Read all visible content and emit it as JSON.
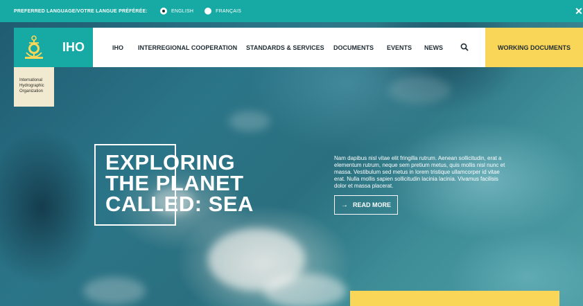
{
  "language_bar": {
    "label": "PREFERRED LANGUAGE/VOTRE LANGUE PRÉFÉRÉE:",
    "options": [
      {
        "label": "ENGLISH",
        "selected": true
      },
      {
        "label": "FRANÇAIS",
        "selected": false
      }
    ],
    "close_icon": "close-icon"
  },
  "header": {
    "logo_icon": "iho-emblem-icon",
    "brand": "IHO",
    "org_name_lines": [
      "International",
      "Hydrographic",
      "Organization"
    ],
    "nav": [
      {
        "label": "IHO"
      },
      {
        "label": "INTERREGIONAL COOPERATION"
      },
      {
        "label": "STANDARDS & SERVICES"
      },
      {
        "label": "DOCUMENTS"
      },
      {
        "label": "EVENTS"
      },
      {
        "label": "NEWS"
      }
    ],
    "search_icon": "search-icon",
    "cta": "WORKING DOCUMENTS"
  },
  "hero": {
    "headline_lines": [
      "EXPLORING",
      "THE PLANET",
      "CALLED: SEA"
    ],
    "lead": "Nam dapibus nisl vitae elit fringilla rutrum. Aenean sollicitudin, erat a elementum rutrum, neque sem pretium metus, quis mollis nisl nunc et massa. Vestibulum sed metus in lorem tristique ullamcorper id vitae erat. Nulla mollis sapien sollicitudin lacinia lacinia. Vivamus facilisis dolor et massa placerat.",
    "read_more": "READ MORE",
    "read_more_icon": "arrow-right-icon"
  },
  "colors": {
    "teal": "#17a9a3",
    "yellow": "#f9d657",
    "cream": "#f2ead0"
  }
}
